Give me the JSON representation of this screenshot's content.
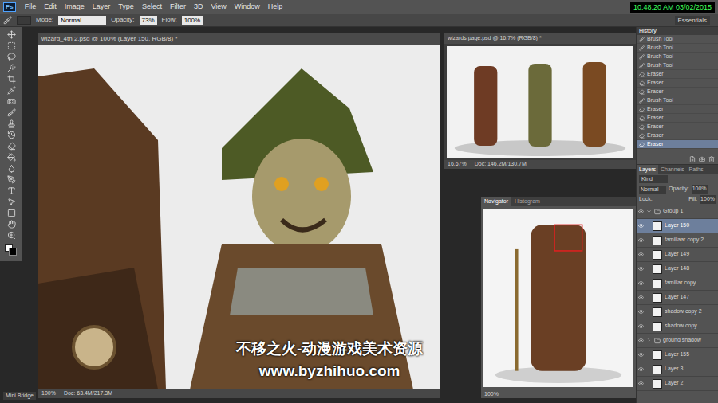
{
  "app": {
    "logo": "Ps",
    "menu": [
      "File",
      "Edit",
      "Image",
      "Layer",
      "Type",
      "Select",
      "Filter",
      "3D",
      "View",
      "Window",
      "Help"
    ]
  },
  "clock": "10:48:20 AM 03/02/2015",
  "workspace": "Essentials",
  "options": {
    "mode_label": "Mode:",
    "mode": "Normal",
    "opacity_label": "Opacity:",
    "opacity": "73%",
    "flow_label": "Flow:",
    "flow": "100%"
  },
  "documents": [
    {
      "title": "wizard_4th 2.psd @ 100% (Layer 150, RGB/8) *",
      "zoom": "100%",
      "doc": "Doc: 63.4M/217.3M"
    },
    {
      "title": "wizards page.psd @ 16.7% (RGB/8) *",
      "zoom": "16.67%",
      "doc": "Doc: 146.2M/130.7M"
    }
  ],
  "navigator": {
    "tabs": [
      {
        "label": "Navigator",
        "selected": true
      },
      {
        "label": "Histogram",
        "selected": false
      }
    ],
    "zoom": "100%"
  },
  "history": {
    "title": "History",
    "items": [
      {
        "label": "Brush Tool",
        "selected": false
      },
      {
        "label": "Brush Tool",
        "selected": false
      },
      {
        "label": "Brush Tool",
        "selected": false
      },
      {
        "label": "Brush Tool",
        "selected": false
      },
      {
        "label": "Eraser",
        "selected": false
      },
      {
        "label": "Eraser",
        "selected": false
      },
      {
        "label": "Eraser",
        "selected": false
      },
      {
        "label": "Brush Tool",
        "selected": false
      },
      {
        "label": "Eraser",
        "selected": false
      },
      {
        "label": "Eraser",
        "selected": false
      },
      {
        "label": "Eraser",
        "selected": false
      },
      {
        "label": "Eraser",
        "selected": false
      },
      {
        "label": "Eraser",
        "selected": true
      }
    ]
  },
  "layers": {
    "tabs": [
      {
        "label": "Layers",
        "selected": true
      },
      {
        "label": "Channels",
        "selected": false
      },
      {
        "label": "Paths",
        "selected": false
      }
    ],
    "kind": "Kind",
    "blend": "Normal",
    "opacity_label": "Opacity:",
    "opacity": "100%",
    "lock_label": "Lock:",
    "fill_label": "Fill:",
    "fill": "100%",
    "items": [
      {
        "name": "Group 1",
        "kind": "group",
        "expanded": true,
        "selected": false
      },
      {
        "name": "Layer 150",
        "kind": "layer",
        "expanded": false,
        "selected": true
      },
      {
        "name": "familiaar copy 2",
        "kind": "layer",
        "expanded": false,
        "selected": false
      },
      {
        "name": "Layer 149",
        "kind": "layer",
        "expanded": false,
        "selected": false
      },
      {
        "name": "Layer 148",
        "kind": "layer",
        "expanded": false,
        "selected": false
      },
      {
        "name": "familiar copy",
        "kind": "layer",
        "expanded": false,
        "selected": false
      },
      {
        "name": "Layer 147",
        "kind": "layer",
        "expanded": false,
        "selected": false
      },
      {
        "name": "shadow copy 2",
        "kind": "layer",
        "expanded": false,
        "selected": false
      },
      {
        "name": "shadow copy",
        "kind": "layer",
        "expanded": false,
        "selected": false
      },
      {
        "name": "ground shadow",
        "kind": "group",
        "expanded": false,
        "selected": false
      },
      {
        "name": "Layer 155",
        "kind": "layer",
        "expanded": false,
        "selected": false
      },
      {
        "name": "Layer 3",
        "kind": "layer",
        "expanded": false,
        "selected": false
      },
      {
        "name": "Layer 2",
        "kind": "layer",
        "expanded": false,
        "selected": false
      }
    ]
  },
  "mini_bridge": "Mini Bridge",
  "watermark": [
    "不移之火-动漫游戏美术资源",
    "www.byzhihuo.com"
  ]
}
